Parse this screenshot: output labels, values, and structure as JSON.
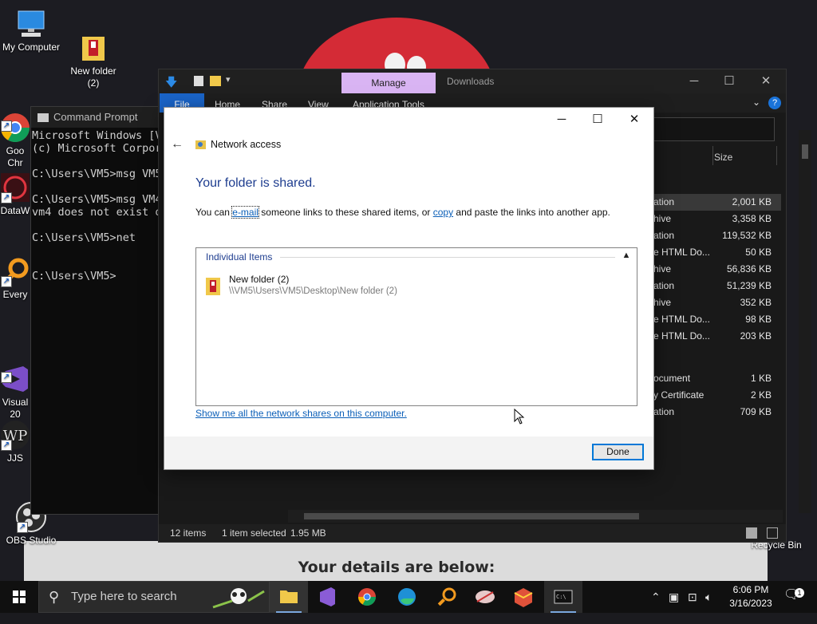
{
  "desktop": {
    "icons": [
      {
        "label": "My Computer"
      },
      {
        "label": "New folder\n(2)"
      },
      {
        "label": "Goo\nChr"
      },
      {
        "label": "DataW"
      },
      {
        "label": "Every"
      },
      {
        "label": "Visual\n20"
      },
      {
        "label": "JJS"
      },
      {
        "label": "OBS Studio"
      },
      {
        "label": "Recycle Bin"
      }
    ],
    "wallpaper_caption": "Your details are below:"
  },
  "cmd": {
    "title": "Command Prompt",
    "lines": [
      "Microsoft Windows [V",
      "(c) Microsoft Corpor",
      "",
      "C:\\Users\\VM5>msg VM5",
      "",
      "C:\\Users\\VM5>msg VM4",
      "vm4 does not exist o",
      "",
      "C:\\Users\\VM5>net",
      "",
      "",
      "C:\\Users\\VM5>"
    ]
  },
  "explorer": {
    "manage_tab": "Manage",
    "title": "Downloads",
    "ribbon_tabs": [
      "File",
      "Home",
      "Share",
      "View",
      "Application Tools"
    ],
    "size_header": "Size",
    "rows": [
      {
        "type": "ation",
        "size": "2,001 KB",
        "selected": true
      },
      {
        "type": "hive",
        "size": "3,358 KB"
      },
      {
        "type": "ation",
        "size": "119,532 KB"
      },
      {
        "type": "e HTML Do...",
        "size": "50 KB"
      },
      {
        "type": "hive",
        "size": "56,836 KB"
      },
      {
        "type": "ation",
        "size": "51,239 KB"
      },
      {
        "type": "hive",
        "size": "352 KB"
      },
      {
        "type": "e HTML Do...",
        "size": "98 KB"
      },
      {
        "type": "e HTML Do...",
        "size": "203 KB"
      },
      {
        "type": "",
        "size": ""
      },
      {
        "type": "ocument",
        "size": "1 KB"
      },
      {
        "type": "y Certificate",
        "size": "2 KB"
      },
      {
        "type": "ation",
        "size": "709 KB"
      }
    ],
    "status": {
      "items": "12 items",
      "selected": "1 item selected",
      "size": "1.95 MB"
    }
  },
  "dialog": {
    "title": "Network access",
    "heading": "Your folder is shared.",
    "desc_pre": "You can ",
    "desc_email": "e-mail",
    "desc_mid": " someone links to these shared items, or ",
    "desc_copy": "copy",
    "desc_post": " and paste the links into another app.",
    "items_header": "Individual Items",
    "item_name": "New folder (2)",
    "item_path": "\\\\VM5\\Users\\VM5\\Desktop\\New folder (2)",
    "show_link": "Show me all the network shares on this computer.",
    "done_label": "Done"
  },
  "taskbar": {
    "search_placeholder": "Type here to search",
    "time": "6:06 PM",
    "date": "3/16/2023"
  }
}
